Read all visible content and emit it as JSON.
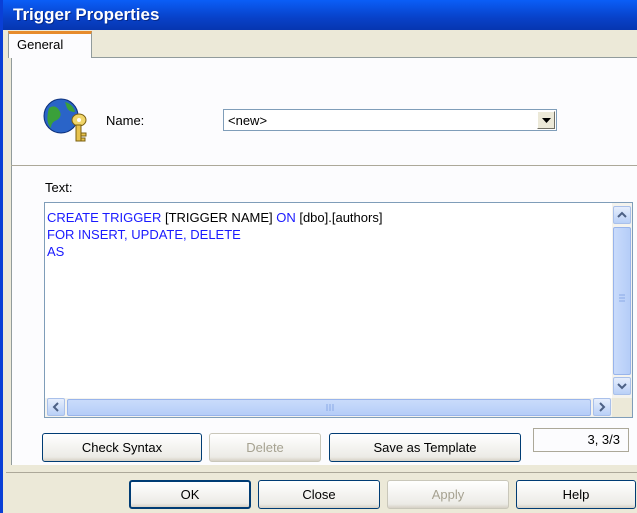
{
  "window": {
    "title": "Trigger Properties"
  },
  "tabs": [
    {
      "label": "General"
    }
  ],
  "name_field": {
    "label": "Name:",
    "value": "<new>"
  },
  "text_field": {
    "label": "Text:",
    "lines": [
      {
        "kw1": "CREATE TRIGGER ",
        "t1": "[TRIGGER NAME] ",
        "kw2": "ON",
        "t2": " [dbo].[authors]"
      },
      {
        "kw1": "FOR INSERT, UPDATE, DELETE"
      },
      {
        "kw1": "AS"
      }
    ]
  },
  "editor_buttons": {
    "check_syntax": "Check Syntax",
    "delete": "Delete",
    "save_as_template": "Save as Template"
  },
  "cursor_position": "3, 3/3",
  "dialog_buttons": {
    "ok": "OK",
    "close": "Close",
    "apply": "Apply",
    "help": "Help"
  },
  "icons": {
    "object": "globe-key-icon",
    "dropdown": "chevron-down-icon"
  },
  "colors": {
    "titlebar": "#0a5ef7",
    "keyword": "#1a1aff",
    "tab_accent": "#e68b2c"
  }
}
